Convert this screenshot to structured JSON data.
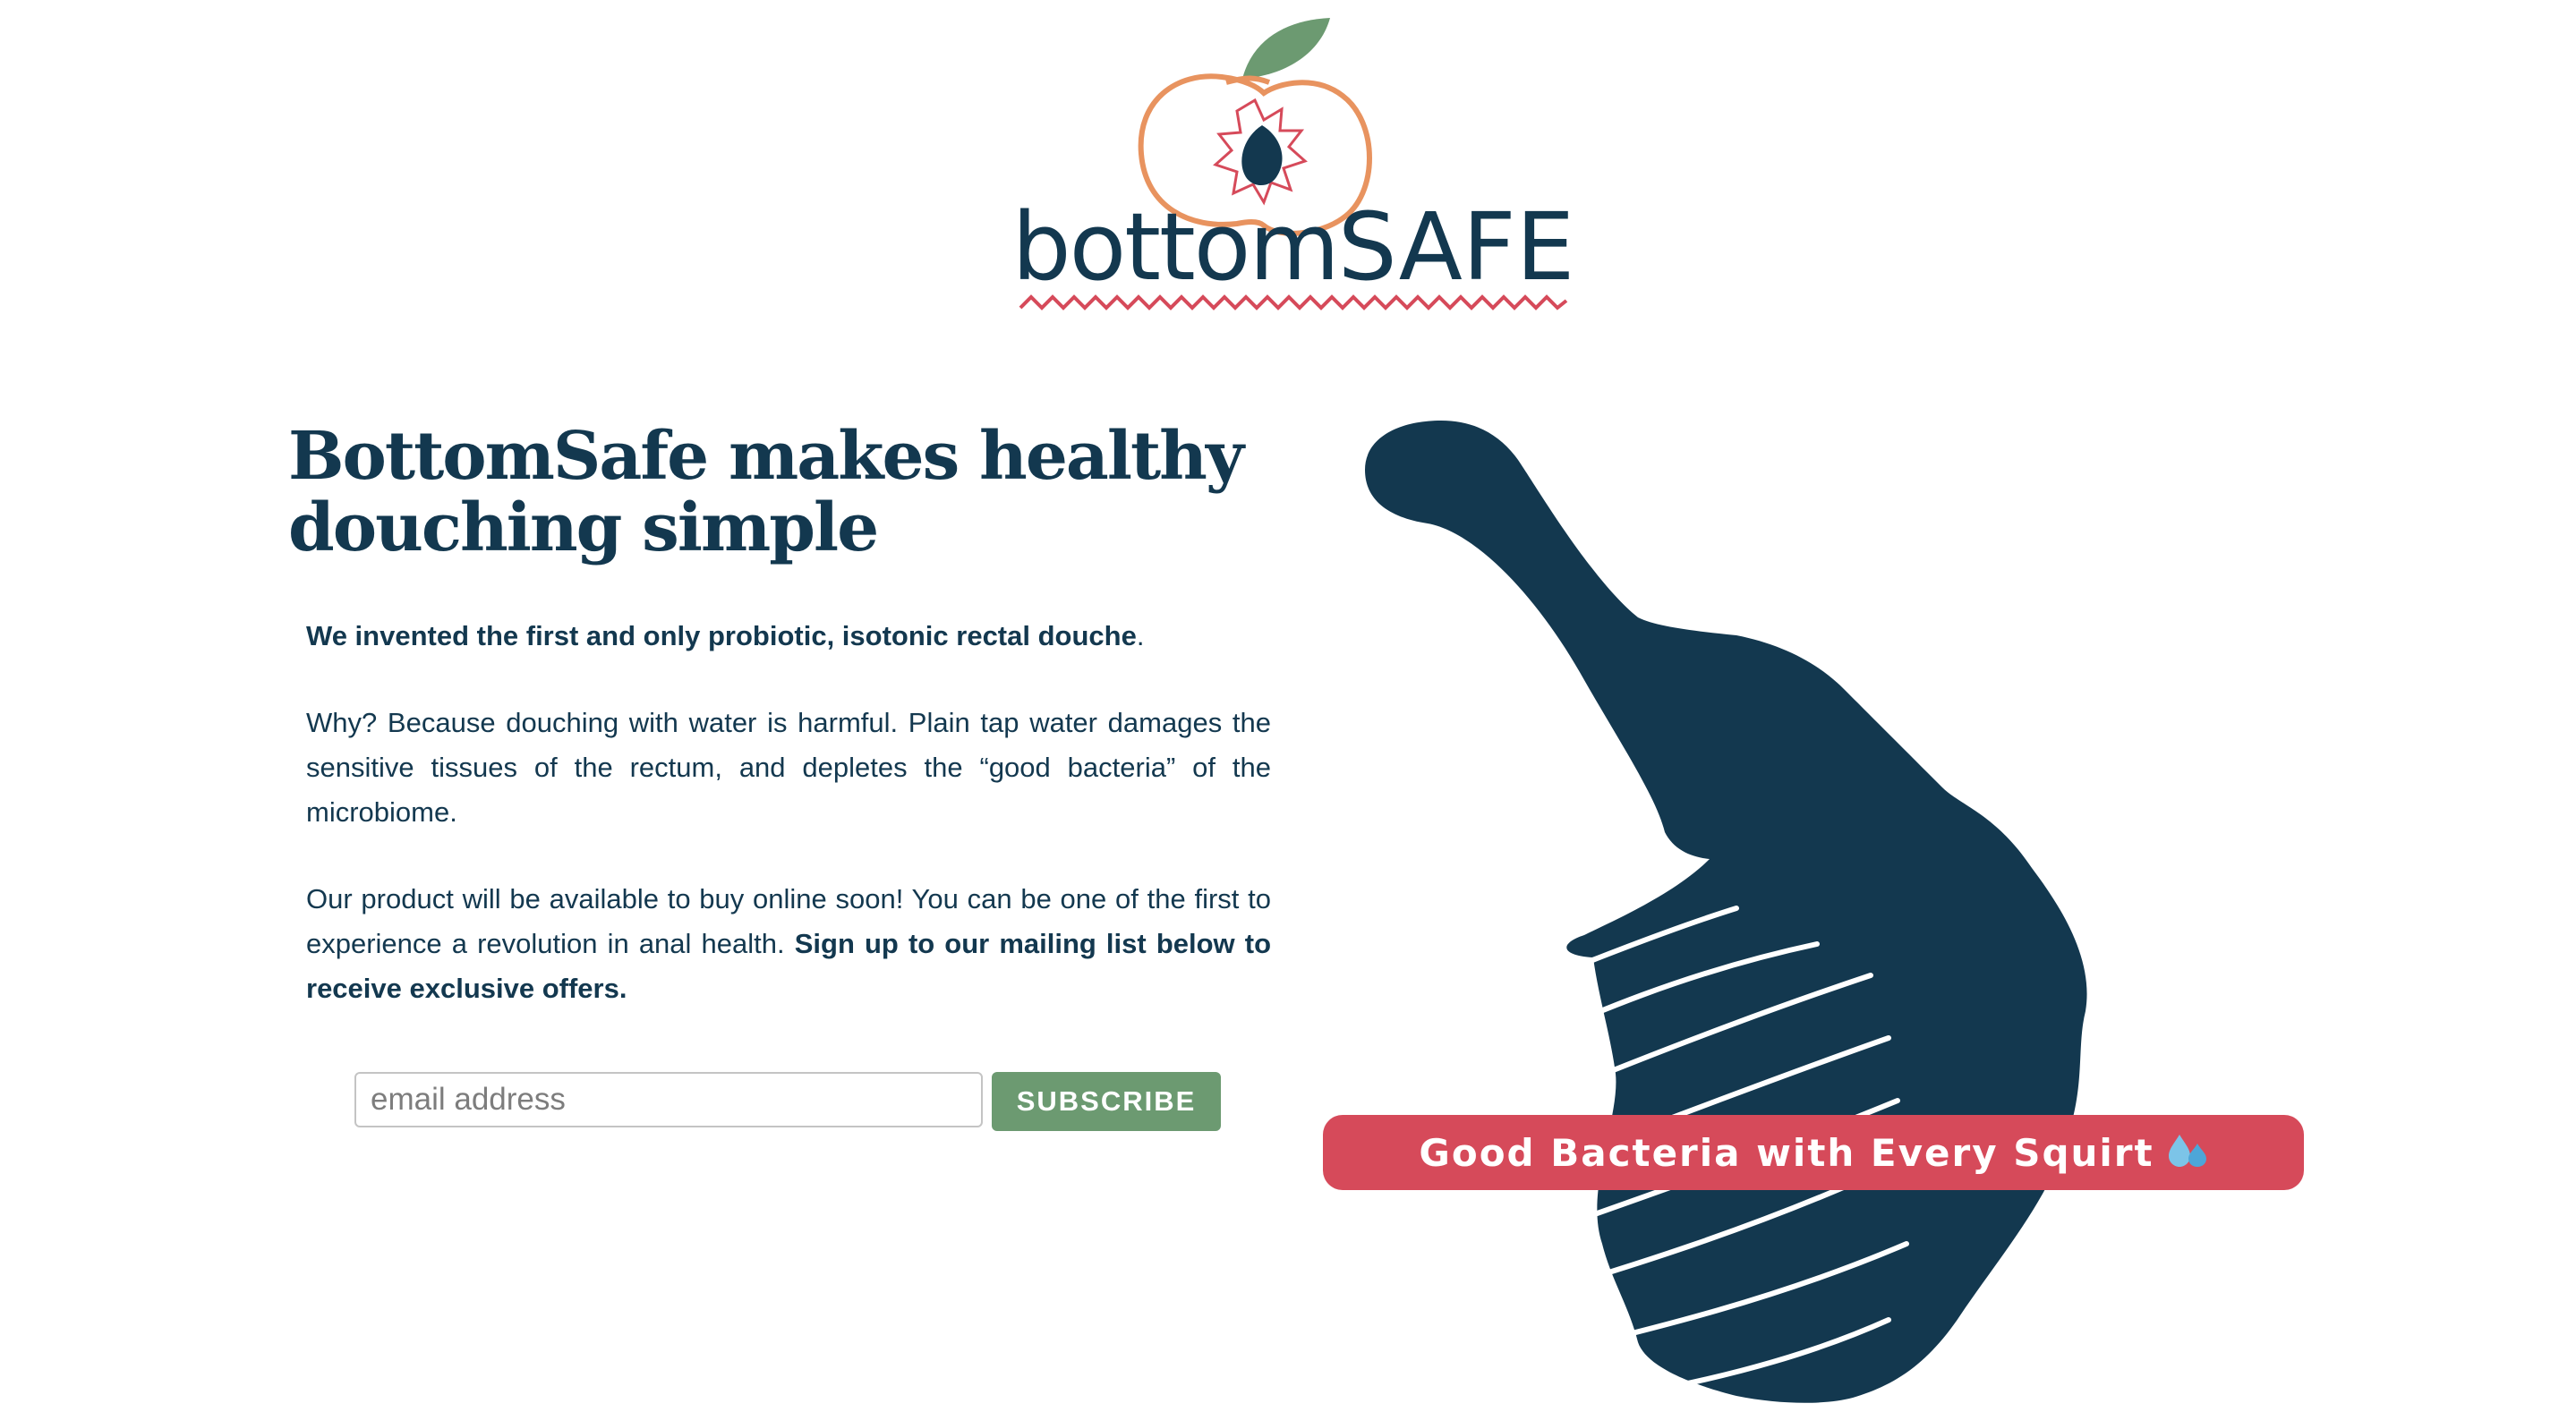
{
  "brand": {
    "name_prefix": "bottom",
    "name_suffix": "SAFE",
    "colors": {
      "navy": "#13384f",
      "peach": "#e8935f",
      "coral": "#d64a5a",
      "leaf": "#6c9a71"
    }
  },
  "hero": {
    "title": "BottomSafe makes healthy douching simple",
    "intro_bold": "We invented the first and only probiotic, isotonic rectal douche",
    "intro_end": ".",
    "why": "Why? Because douching with water is harmful. Plain tap water damages the sensitive tissues of the rectum, and depletes the “good bacteria” of the microbiome.",
    "availability": "Our product will be available to buy online soon! You can be one of the first to experience a revolution in anal health.",
    "signup_prompt": "Sign up to our mailing list below to receive exclusive offers."
  },
  "signup": {
    "email_placeholder": "email address",
    "email_value": "",
    "button_label": "SUBSCRIBE"
  },
  "banner": {
    "text": "Good Bacteria with Every Squirt",
    "icon": "sweat-droplets-icon"
  },
  "icons": {
    "logo": "peach-logo-icon",
    "product": "douche-bulb-icon"
  }
}
